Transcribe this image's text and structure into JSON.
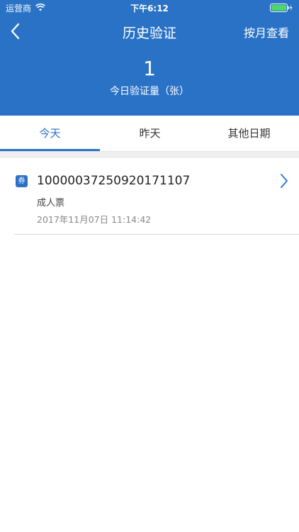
{
  "status_bar": {
    "carrier": "运营商",
    "time": "下午6:12",
    "icons": [
      "wifi-icon",
      "battery-icon"
    ]
  },
  "nav": {
    "title": "历史验证",
    "back_icon": "chevron-left-icon",
    "right_button": "按月查看"
  },
  "summary": {
    "count": "1",
    "label": "今日验证量（张）"
  },
  "tabs": [
    {
      "label": "今天",
      "active": true
    },
    {
      "label": "昨天",
      "active": false
    },
    {
      "label": "其他日期",
      "active": false
    }
  ],
  "records": [
    {
      "badge": "券",
      "number": "10000037250920171107",
      "type": "成人票",
      "time": "2017年11月07日  11:14:42"
    }
  ],
  "colors": {
    "primary": "#2a72c6",
    "background": "#ffffff",
    "separator": "#efefef"
  }
}
